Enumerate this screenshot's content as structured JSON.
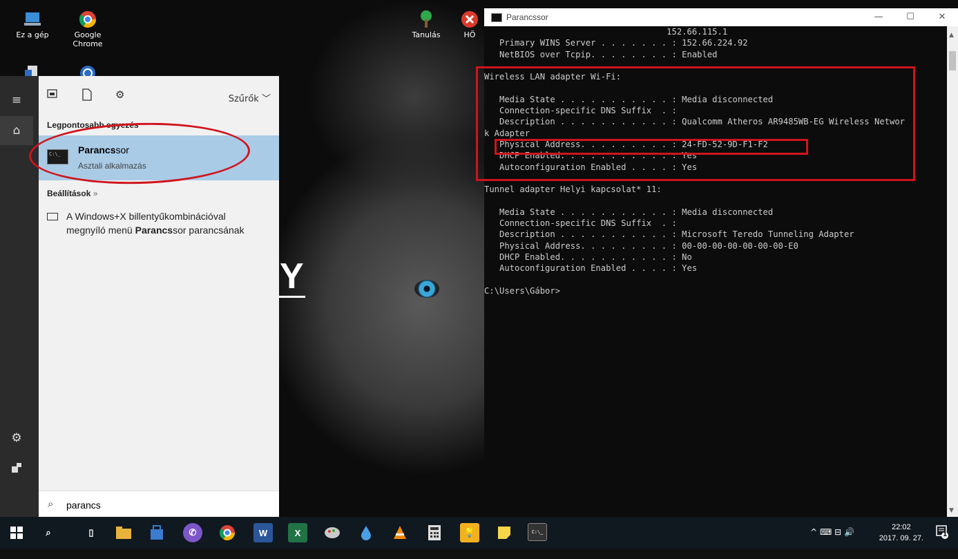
{
  "desktop": {
    "icons": [
      {
        "label": "Ez a gép"
      },
      {
        "label": "Google Chrome"
      },
      {
        "label": "Tanulás"
      },
      {
        "label": "HÖ"
      }
    ],
    "wallpaper_letter": "Y"
  },
  "start_menu": {
    "filter_label": "Szűrők",
    "best_match_label": "Legpontosabb egyezés",
    "best_match": {
      "title_bold": "Parancs",
      "title_rest": "sor",
      "subtitle": "Asztali alkalmazás"
    },
    "settings_label": "Beállítások",
    "settings_arrow": "»",
    "setting_item": {
      "line1": "A Windows+X billentyűkombinációval",
      "line2_pre": "megnyíló menü ",
      "line2_bold": "Parancs",
      "line2_post": "sor parancsának"
    },
    "search_value": "parancs"
  },
  "console": {
    "title": "Parancssor",
    "lines": [
      "                                    152.66.115.1",
      "   Primary WINS Server . . . . . . . : 152.66.224.92",
      "   NetBIOS over Tcpip. . . . . . . . : Enabled",
      "",
      "Wireless LAN adapter Wi-Fi:",
      "",
      "   Media State . . . . . . . . . . . : Media disconnected",
      "   Connection-specific DNS Suffix  . :",
      "   Description . . . . . . . . . . . : Qualcomm Atheros AR9485WB-EG Wireless Networ",
      "k Adapter",
      "   Physical Address. . . . . . . . . : 24-FD-52-9D-F1-F2",
      "   DHCP Enabled. . . . . . . . . . . : Yes",
      "   Autoconfiguration Enabled . . . . : Yes",
      "",
      "Tunnel adapter Helyi kapcsolat* 11:",
      "",
      "   Media State . . . . . . . . . . . : Media disconnected",
      "   Connection-specific DNS Suffix  . :",
      "   Description . . . . . . . . . . . : Microsoft Teredo Tunneling Adapter",
      "   Physical Address. . . . . . . . . : 00-00-00-00-00-00-00-E0",
      "   DHCP Enabled. . . . . . . . . . . : No",
      "   Autoconfiguration Enabled . . . . : Yes",
      "",
      "C:\\Users\\Gábor>"
    ]
  },
  "taskbar": {
    "apps": [
      "start-icon",
      "search-icon",
      "task-view-icon",
      "file-explorer-icon",
      "store-icon",
      "viber-icon",
      "chrome-icon",
      "word-icon",
      "excel-icon",
      "paint-icon",
      "droplet-icon",
      "vlc-icon",
      "calculator-icon",
      "tips-icon",
      "sticky-notes-icon",
      "cmd-icon"
    ],
    "app_texts": {
      "word": "W",
      "excel": "X"
    },
    "tray_glyphs": "^  ⌨  ⊟  🔊",
    "time": "22:02",
    "date": "2017. 09. 27.",
    "notification_count": "1"
  },
  "colors": {
    "accent": "#a9cbe6",
    "highlight_red": "#d0141c",
    "console_bg": "#0c0c0c",
    "console_fg": "#cccccc"
  }
}
